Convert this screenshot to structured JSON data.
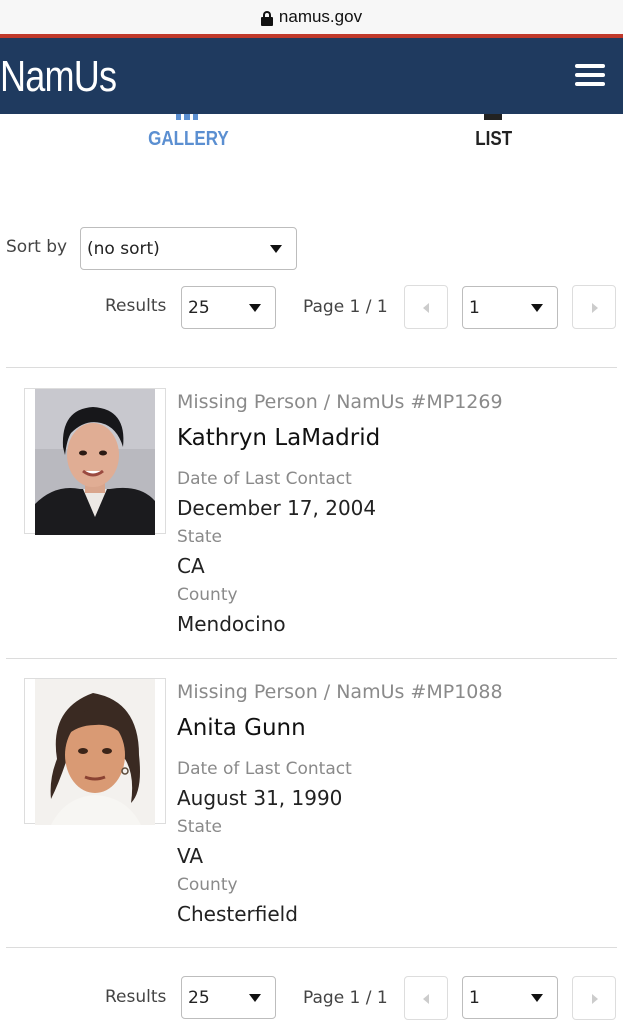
{
  "browser": {
    "url": "namus.gov"
  },
  "header": {
    "logo": "NamUs"
  },
  "view_tabs": {
    "gallery": "GALLERY",
    "list": "LIST",
    "active": "gallery"
  },
  "sort": {
    "label": "Sort by",
    "value": "(no sort)"
  },
  "pagination": {
    "results_label": "Results",
    "results_value": "25",
    "page_text": "Page 1 / 1",
    "page_value": "1"
  },
  "cases": [
    {
      "meta": "Missing Person / NamUs #MP1269",
      "name": "Kathryn LaMadrid",
      "date_label": "Date of Last Contact",
      "date": "December 17, 2004",
      "state_label": "State",
      "state": "CA",
      "county_label": "County",
      "county": "Mendocino"
    },
    {
      "meta": "Missing Person / NamUs #MP1088",
      "name": "Anita Gunn",
      "date_label": "Date of Last Contact",
      "date": "August 31, 1990",
      "state_label": "State",
      "state": "VA",
      "county_label": "County",
      "county": "Chesterfield"
    }
  ],
  "colors": {
    "header": "#1f3a5f",
    "accent_line": "#c0392b",
    "active_tab": "#5b8fd1"
  }
}
